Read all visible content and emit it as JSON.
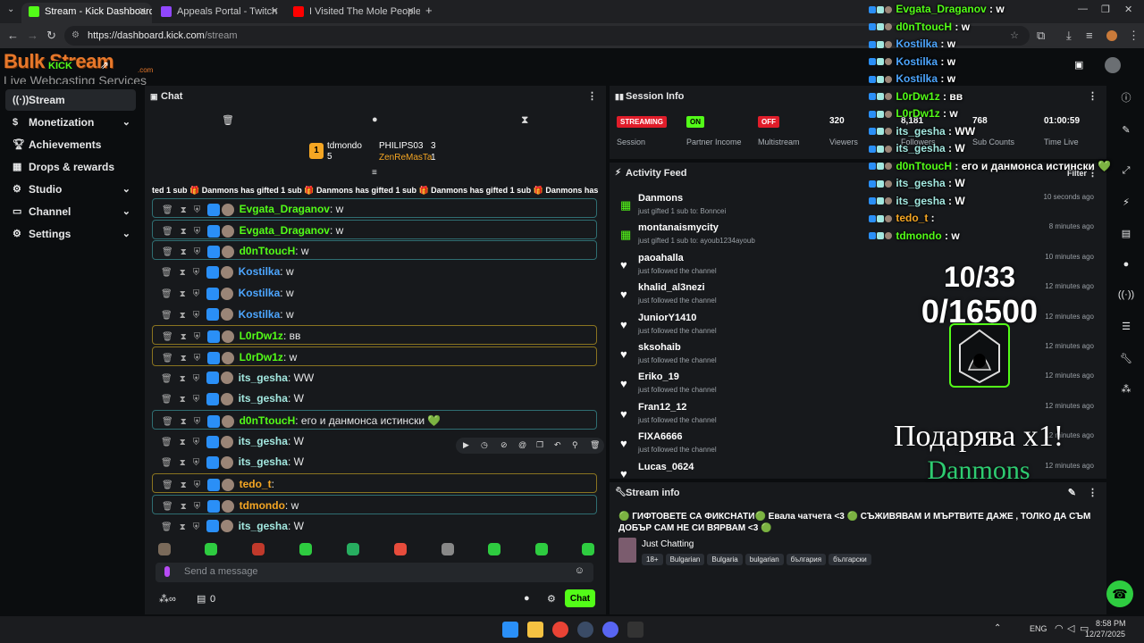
{
  "browser": {
    "tabs": [
      {
        "title": "Stream - Kick Dashboard",
        "color": "#53fc18"
      },
      {
        "title": "Appeals Portal - Twitch",
        "color": "#9147ff"
      },
      {
        "title": "I Visited The Mole People Unde",
        "color": "#ff0000"
      }
    ],
    "url_host": "https://dashboard.kick.com",
    "url_path": "/stream"
  },
  "header": {
    "logo_text": "Bulk Stream",
    "logo_sub": "Live Webcasting Services",
    "logo_badge": "KICK",
    "logo_com": ".com"
  },
  "sidebar": {
    "items": [
      {
        "label": "Stream",
        "icon": "radio-icon",
        "active": true,
        "chevron": false
      },
      {
        "label": "Monetization",
        "icon": "dollar-icon",
        "active": false,
        "chevron": true
      },
      {
        "label": "Achievements",
        "icon": "trophy-icon",
        "active": false,
        "chevron": false
      },
      {
        "label": "Drops & rewards",
        "icon": "gift-icon",
        "active": false,
        "chevron": false
      },
      {
        "label": "Studio",
        "icon": "gear-icon",
        "active": false,
        "chevron": true
      },
      {
        "label": "Channel",
        "icon": "tv-icon",
        "active": false,
        "chevron": true
      },
      {
        "label": "Settings",
        "icon": "cog-icon",
        "active": false,
        "chevron": true
      }
    ]
  },
  "chat": {
    "title": "Chat",
    "leaderboard": [
      {
        "rank": "1",
        "name": "tdmondo",
        "count": "5"
      },
      {
        "rank": "",
        "name": "PHILIPS03",
        "count": "3"
      },
      {
        "rank": "",
        "name": "ZenReMasTa",
        "count": "1"
      }
    ],
    "gift_ticker": "ted 1 sub  🎁 Danmons has gifted 1 sub  🎁 Danmons has gifted 1 sub  🎁 Danmons has gifted 1 sub  🎁 Danmons has",
    "messages": [
      {
        "user": "Evgata_Draganov",
        "text": "w",
        "color": "#53fc18",
        "border": "b-cyan"
      },
      {
        "user": "Evgata_Draganov",
        "text": "w",
        "color": "#53fc18",
        "border": "b-cyan"
      },
      {
        "user": "d0nTtoucH",
        "text": "w",
        "color": "#53fc18",
        "border": "b-cyan"
      },
      {
        "user": "Kostilka",
        "text": "w",
        "color": "#4da6ff",
        "border": ""
      },
      {
        "user": "Kostilka",
        "text": "w",
        "color": "#4da6ff",
        "border": ""
      },
      {
        "user": "Kostilka",
        "text": "w",
        "color": "#4da6ff",
        "border": ""
      },
      {
        "user": "L0rDw1z",
        "text": "вв",
        "color": "#53fc18",
        "border": "b-gold"
      },
      {
        "user": "L0rDw1z",
        "text": "w",
        "color": "#53fc18",
        "border": "b-gold"
      },
      {
        "user": "its_gesha",
        "text": "WW",
        "color": "#a3e8e0",
        "border": ""
      },
      {
        "user": "its_gesha",
        "text": "W",
        "color": "#a3e8e0",
        "border": ""
      },
      {
        "user": "d0nTtoucH",
        "text": "его и данмонса истински 💚",
        "color": "#53fc18",
        "border": "b-cyan"
      },
      {
        "user": "its_gesha",
        "text": "W",
        "color": "#a3e8e0",
        "border": ""
      },
      {
        "user": "its_gesha",
        "text": "W",
        "color": "#a3e8e0",
        "border": ""
      },
      {
        "user": "tedo_t",
        "text": "",
        "color": "#f5a623",
        "border": "b-gold"
      },
      {
        "user": "tdmondo",
        "text": "w",
        "color": "#f5a623",
        "border": "b-cyan"
      },
      {
        "user": "its_gesha",
        "text": "W",
        "color": "#a3e8e0",
        "border": ""
      }
    ],
    "input_placeholder": "Send a message",
    "footer_count": "0",
    "chat_button": "Chat"
  },
  "session": {
    "title": "Session Info",
    "stats": [
      {
        "value": "STREAMING",
        "label": "Session",
        "kind": "pill",
        "color": "#e11d2a"
      },
      {
        "value": "ON",
        "label": "Partner Income",
        "kind": "pill",
        "color": "#53fc18"
      },
      {
        "value": "OFF",
        "label": "Multistream",
        "kind": "pill",
        "color": "#e11d2a"
      },
      {
        "value": "320",
        "label": "Viewers",
        "kind": "text"
      },
      {
        "value": "8,181",
        "label": "Followers",
        "kind": "text"
      },
      {
        "value": "768",
        "label": "Sub Counts",
        "kind": "text"
      },
      {
        "value": "01:00:59",
        "label": "Time Live",
        "kind": "text"
      }
    ]
  },
  "activity": {
    "title": "Activity Feed",
    "filter": "Filter",
    "items": [
      {
        "name": "Danmons",
        "sub": "just gifted 1 sub to: Bonncei",
        "time": "10 seconds ago",
        "icon": "gift-icon"
      },
      {
        "name": "montanaismycity",
        "sub": "just gifted 1 sub to: ayoub1234ayoub",
        "time": "8 minutes ago",
        "icon": "gift-icon"
      },
      {
        "name": "paoahalla",
        "sub": "just followed the channel",
        "time": "10 minutes ago",
        "icon": "heart-icon"
      },
      {
        "name": "khalid_al3nezi",
        "sub": "just followed the channel",
        "time": "12 minutes ago",
        "icon": "heart-icon"
      },
      {
        "name": "JuniorY1410",
        "sub": "just followed the channel",
        "time": "12 minutes ago",
        "icon": "heart-icon"
      },
      {
        "name": "sksohaib",
        "sub": "just followed the channel",
        "time": "12 minutes ago",
        "icon": "heart-icon"
      },
      {
        "name": "Eriko_19",
        "sub": "just followed the channel",
        "time": "12 minutes ago",
        "icon": "heart-icon"
      },
      {
        "name": "Fran12_12",
        "sub": "just followed the channel",
        "time": "12 minutes ago",
        "icon": "heart-icon"
      },
      {
        "name": "FIXA6666",
        "sub": "just followed the channel",
        "time": "12 minutes ago",
        "icon": "heart-icon"
      },
      {
        "name": "Lucas_0624",
        "sub": "",
        "time": "12 minutes ago",
        "icon": "heart-icon"
      }
    ]
  },
  "stream_info": {
    "title": "Stream info",
    "stream_title": "🟢 ГИФТОВЕТЕ СА ФИКСНАТИ🟢 Евала чатчета <3 🟢 СЪЖИВЯВАМ И МЪРТВИТЕ ДАЖЕ , ТОЛКО ДА СЪМ ДОБЪР САМ НЕ СИ ВЯРВАМ <3 🟢",
    "category": "Just Chatting",
    "tags": [
      "18+",
      "Bulgarian",
      "Bulgaria",
      "bulgarian",
      "българия",
      "български"
    ]
  },
  "overlay": {
    "chat": [
      {
        "user": "Evgata_Draganov",
        "text": "w",
        "color": "#53fc18"
      },
      {
        "user": "d0nTtoucH",
        "text": "w",
        "color": "#53fc18"
      },
      {
        "user": "Kostilka",
        "text": "w",
        "color": "#4da6ff"
      },
      {
        "user": "Kostilka",
        "text": "w",
        "color": "#4da6ff"
      },
      {
        "user": "Kostilka",
        "text": "w",
        "color": "#4da6ff"
      },
      {
        "user": "L0rDw1z",
        "text": "вв",
        "color": "#53fc18"
      },
      {
        "user": "L0rDw1z",
        "text": "w",
        "color": "#53fc18"
      },
      {
        "user": "its_gesha",
        "text": "WW",
        "color": "#a3e8e0"
      },
      {
        "user": "its_gesha",
        "text": "W",
        "color": "#a3e8e0"
      },
      {
        "user": "d0nTtoucH",
        "text": "его и данмонса истински 💚",
        "color": "#53fc18"
      },
      {
        "user": "its_gesha",
        "text": "W",
        "color": "#a3e8e0"
      },
      {
        "user": "its_gesha",
        "text": "W",
        "color": "#a3e8e0"
      },
      {
        "user": "tedo_t",
        "text": "",
        "color": "#f5a623"
      },
      {
        "user": "tdmondo",
        "text": "w",
        "color": "#53fc18"
      }
    ],
    "goal_subs": "10/33",
    "goal_points": "0/16500",
    "gift_banner": "Подарява x1!",
    "gift_user": "Danmons"
  },
  "taskbar": {
    "lang": "ENG",
    "time": "8:58 PM",
    "date": "12/27/2025"
  }
}
